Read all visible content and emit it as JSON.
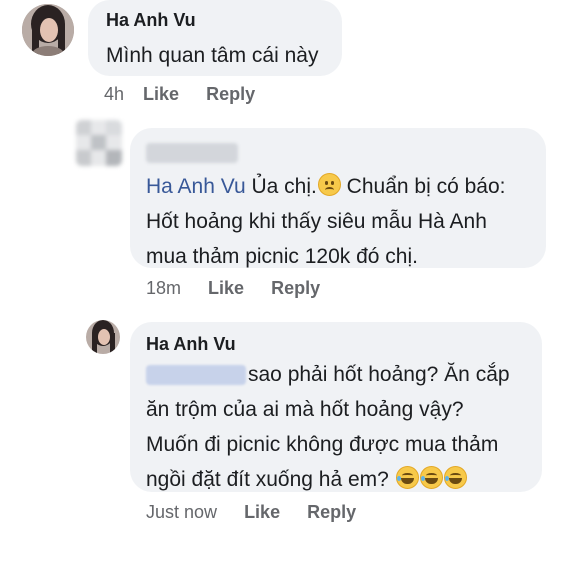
{
  "comments": [
    {
      "author": "Ha Anh Vu",
      "text": "Mình quan tâm cái này",
      "time": "4h",
      "like": "Like",
      "reply": "Reply"
    },
    {
      "mention": "Ha Anh Vu",
      "line1_rest": " Ủa chị.",
      "line1_end": " Chuẩn bị có báo:",
      "line2": "Hốt hoảng khi thấy siêu mẫu Hà Anh",
      "line3": "mua thảm picnic 120k đó chị.",
      "time": "18m",
      "like": "Like",
      "reply": "Reply"
    },
    {
      "author": "Ha Anh Vu",
      "line1": "sao phải hốt hoảng? Ăn cắp",
      "line2": "ăn trộm của ai mà hốt hoảng vậy?",
      "line3": "Muốn đi picnic không được mua thảm",
      "line4": "ngồi đặt đít xuống hả em?",
      "time": "Just now",
      "like": "Like",
      "reply": "Reply"
    }
  ],
  "icons": {
    "sad": "sad-face-emoji-icon",
    "laugh": "rofl-emoji-icon"
  },
  "colors": {
    "bubble": "#f0f2f5",
    "mention": "#385898",
    "meta": "#65676b"
  }
}
